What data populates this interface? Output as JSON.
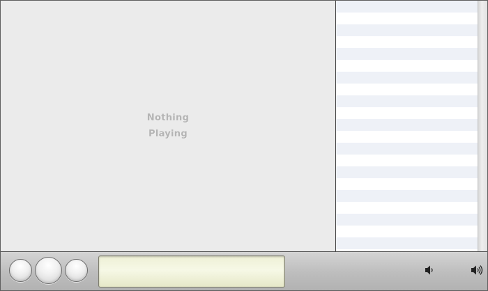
{
  "player": {
    "status_line_1": "Nothing",
    "status_line_2": "Playing"
  },
  "controls": {
    "previous_icon": "previous-button",
    "play_icon": "play-button",
    "next_icon": "next-button",
    "volume_low_icon": "volume-low-icon",
    "volume_high_icon": "volume-high-icon"
  },
  "colors": {
    "background": "#ebebeb",
    "playlist_stripe": "#eef1f7",
    "lcd": "#f3f5de",
    "status_text": "#b4b4b4"
  }
}
